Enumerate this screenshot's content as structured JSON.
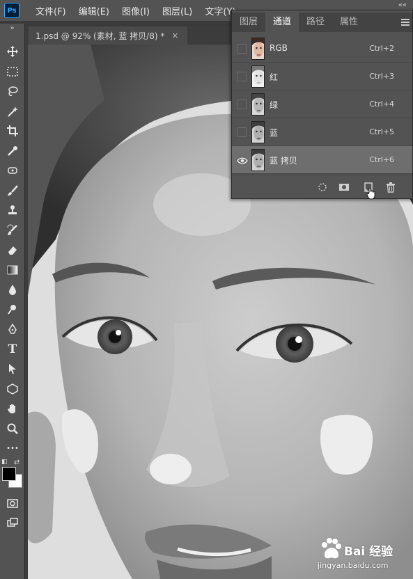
{
  "app": {
    "logo": "Ps"
  },
  "menu": [
    "文件(F)",
    "编辑(E)",
    "图像(I)",
    "图层(L)",
    "文字(Y)"
  ],
  "document_tab": {
    "title": "1.psd @ 92% (素材, 蓝 拷贝/8) *",
    "close": "×"
  },
  "toolbar": {
    "collapse": "»",
    "tools": [
      "move-icon",
      "marquee-icon",
      "lasso-icon",
      "magic-wand-icon",
      "crop-icon",
      "eyedropper-icon",
      "healing-brush-icon",
      "brush-icon",
      "clone-stamp-icon",
      "history-brush-icon",
      "eraser-icon",
      "gradient-icon",
      "blur-icon",
      "dodge-icon",
      "pen-icon",
      "type-icon",
      "path-selection-icon",
      "shape-icon",
      "hand-icon",
      "zoom-icon",
      "more-icon"
    ],
    "type_label": "T",
    "more_label": "•••",
    "foreground": "#000000",
    "background": "#ffffff"
  },
  "panel": {
    "collapse": "««",
    "tabs": [
      "图层",
      "通道",
      "路径",
      "属性"
    ],
    "active_tab": "通道",
    "channels": [
      {
        "name": "RGB",
        "shortcut": "Ctrl+2",
        "visible": false,
        "selected": false,
        "thumb": "color"
      },
      {
        "name": "红",
        "shortcut": "Ctrl+3",
        "visible": false,
        "selected": false,
        "thumb": "light"
      },
      {
        "name": "绿",
        "shortcut": "Ctrl+4",
        "visible": false,
        "selected": false,
        "thumb": "gray"
      },
      {
        "name": "蓝",
        "shortcut": "Ctrl+5",
        "visible": false,
        "selected": false,
        "thumb": "gray"
      },
      {
        "name": "蓝 拷贝",
        "shortcut": "Ctrl+6",
        "visible": true,
        "selected": true,
        "thumb": "gray"
      }
    ],
    "footer_icons": [
      "load-selection-icon",
      "save-selection-icon",
      "new-channel-icon",
      "delete-icon"
    ]
  },
  "watermark": {
    "main": "Bai 经验",
    "sub": "jingyan.baidu.com"
  }
}
